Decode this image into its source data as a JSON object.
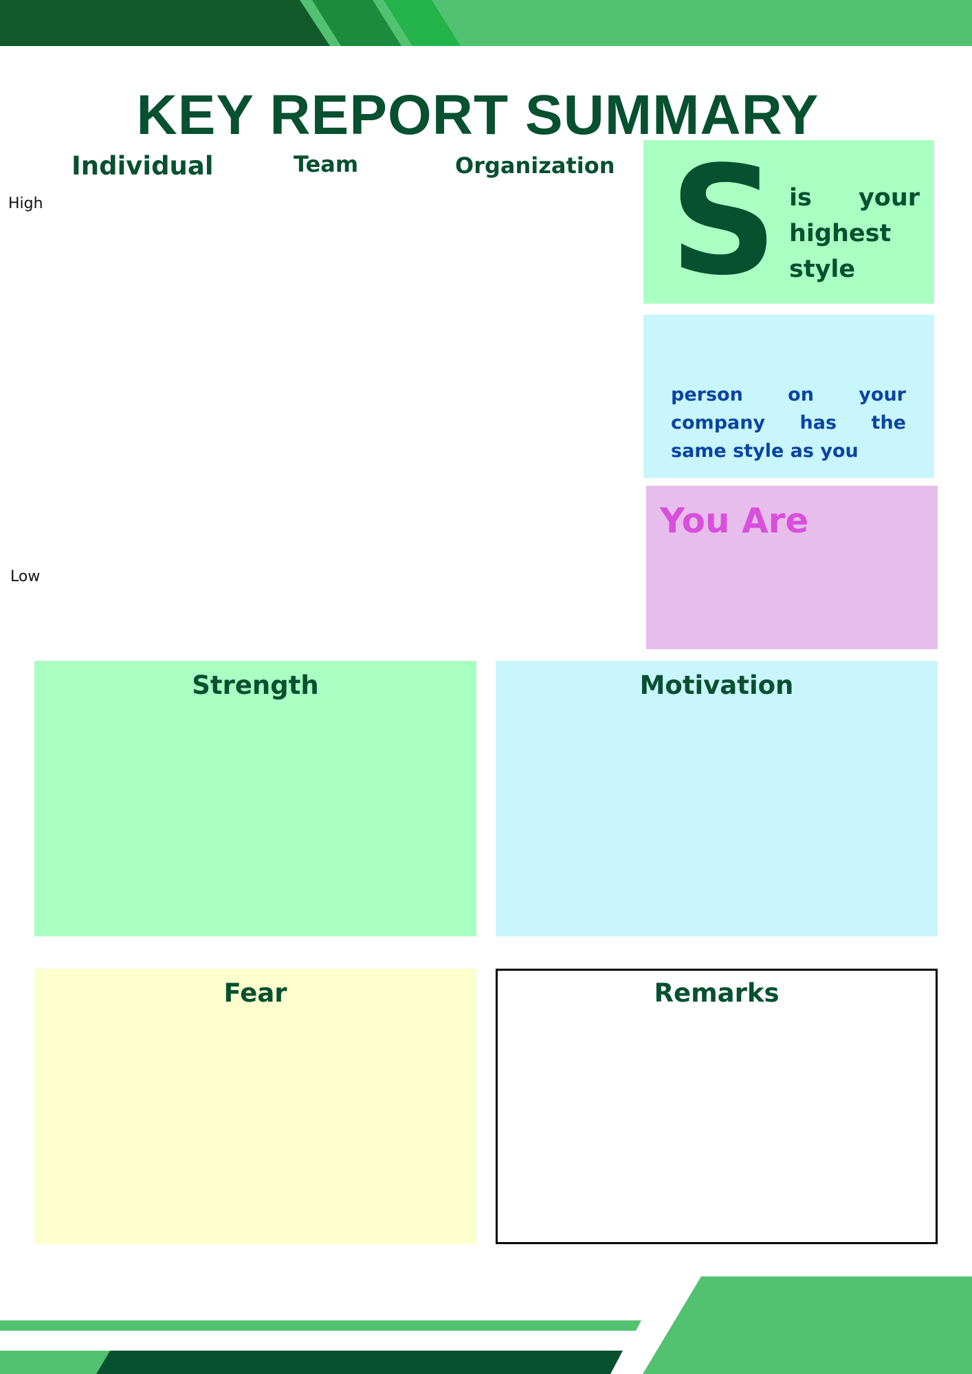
{
  "header": {
    "title": "KEY REPORT SUMMARY"
  },
  "columns": {
    "individual": "Individual",
    "team": "Team",
    "organization": "Organization"
  },
  "axis": {
    "high": "High",
    "low": "Low"
  },
  "style_card": {
    "letter": "S",
    "text": "is your highest style"
  },
  "peer_card": {
    "text": "person on your company has the same style as you"
  },
  "you_are_card": {
    "label": "You Are"
  },
  "sections": {
    "strength": "Strength",
    "motivation": "Motivation",
    "fear": "Fear",
    "remarks": "Remarks"
  },
  "colors": {
    "dark_green": "#075030",
    "mid_green": "#1c8b3e",
    "bright_green": "#23b34a",
    "light_green": "#52c270",
    "mint": "#aaffc2",
    "light_cyan": "#c9f6fc",
    "lavender": "#e7bdeb",
    "pale_yellow": "#fdfece",
    "magenta": "#d84fdb",
    "blue": "#0a44a2"
  }
}
